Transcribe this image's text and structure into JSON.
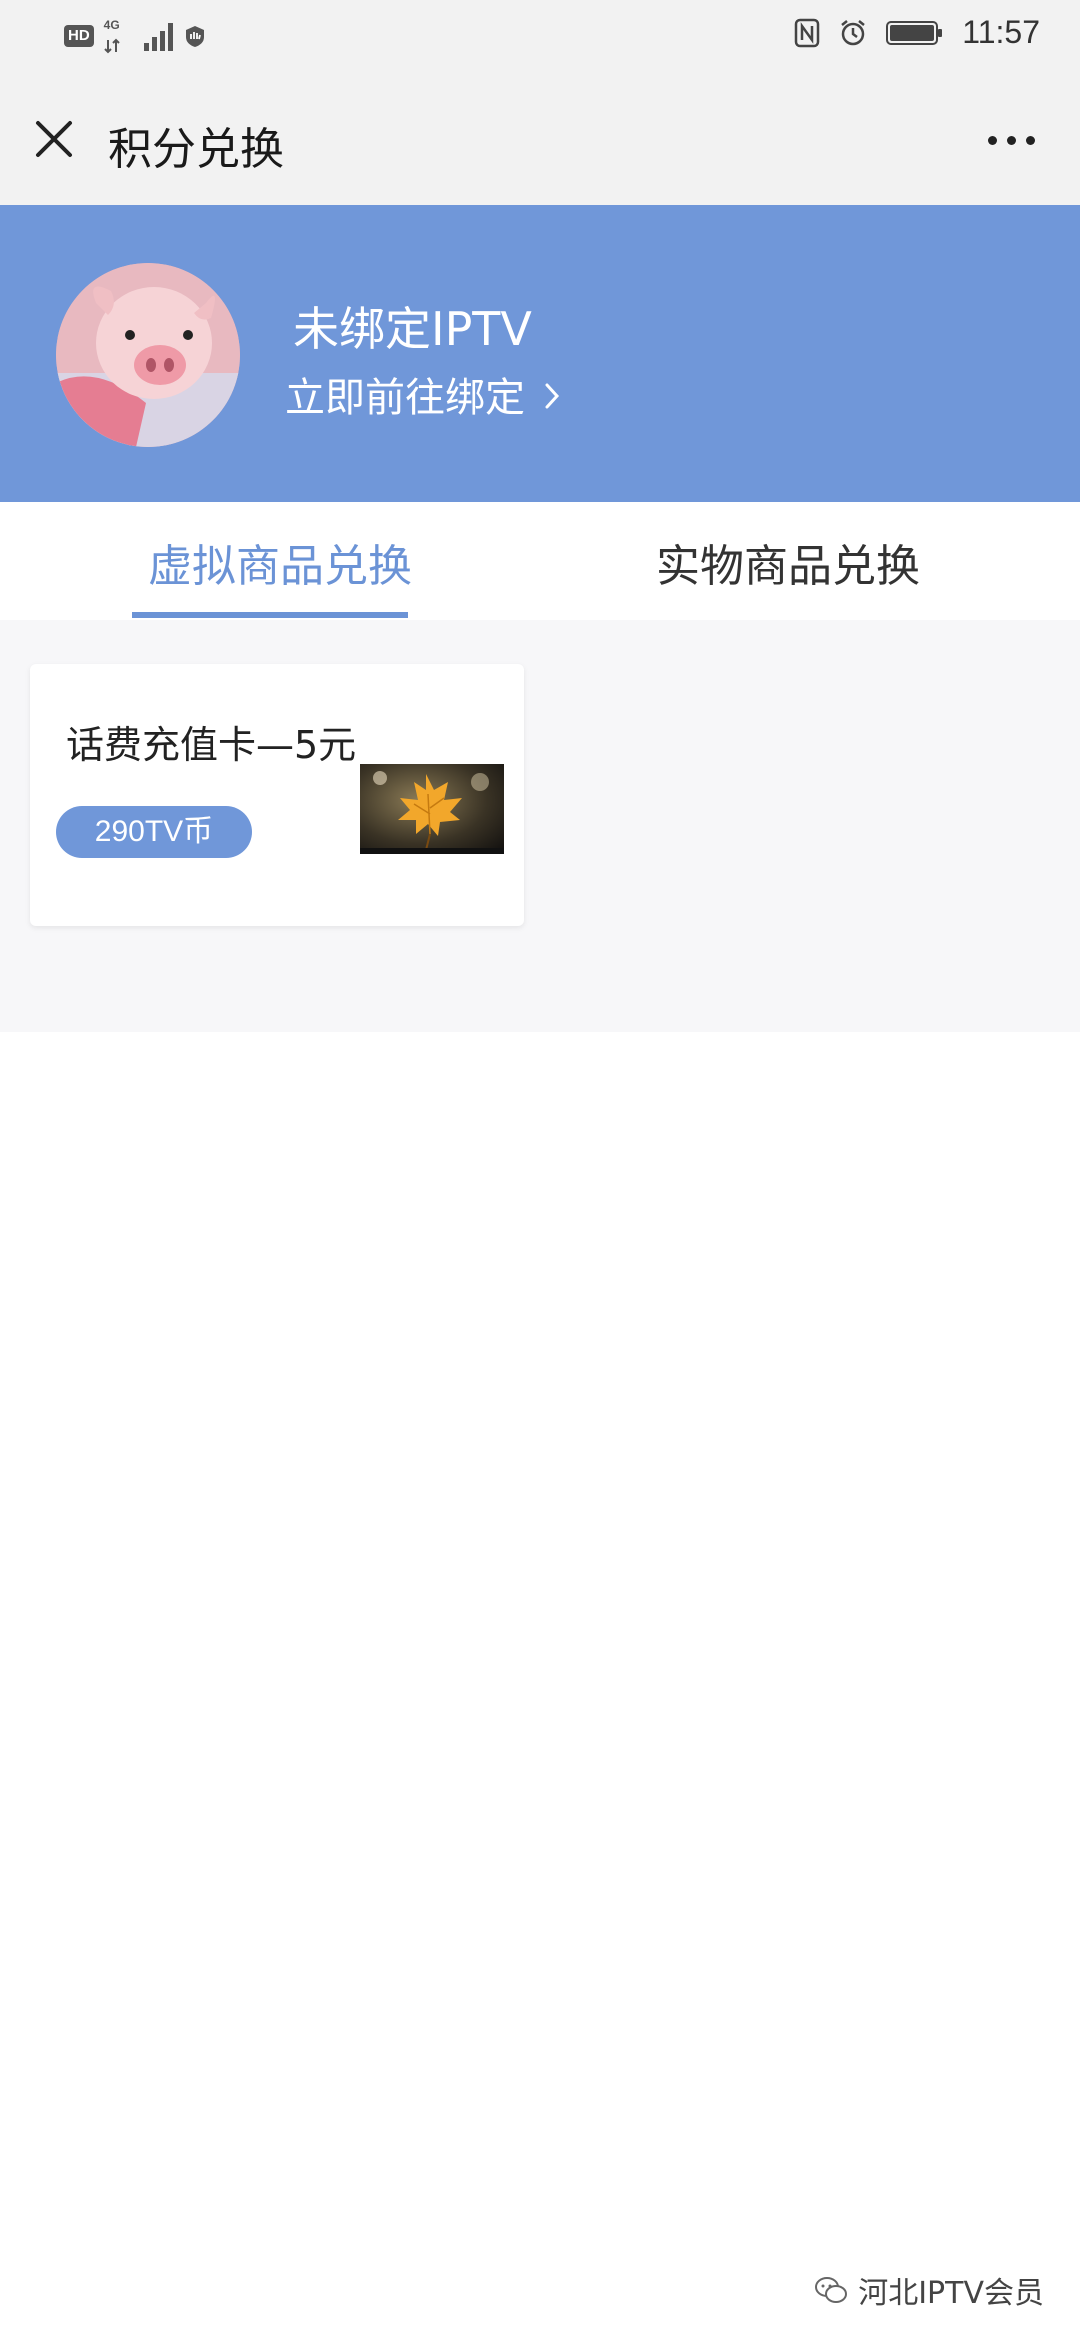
{
  "status_bar": {
    "hd": "HD",
    "network": "4G",
    "time": "11:57",
    "icons": [
      "nfc-icon",
      "alarm-icon",
      "battery-icon"
    ]
  },
  "navbar": {
    "title": "积分兑换",
    "close_icon": "close-icon",
    "more_icon": "more-icon"
  },
  "profile": {
    "status": "未绑定IPTV",
    "bind_action": "立即前往绑定",
    "banner_color": "#7097d9"
  },
  "tabs": [
    {
      "label": "虚拟商品兑换",
      "active": true
    },
    {
      "label": "实物商品兑换",
      "active": false
    }
  ],
  "products": [
    {
      "title": "话费充值卡—5元",
      "price": "290TV币"
    }
  ],
  "watermark": {
    "text": "河北IPTV会员"
  },
  "colors": {
    "accent": "#6b93d6",
    "background": "#f7f7f9"
  }
}
